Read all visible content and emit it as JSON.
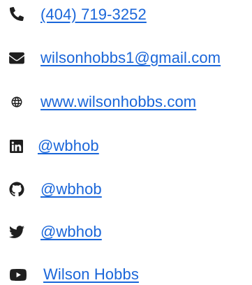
{
  "contacts": [
    {
      "icon": "phone-icon",
      "text": "(404) 719-3252"
    },
    {
      "icon": "envelope-icon",
      "text": "wilsonhobbs1@gmail.com"
    },
    {
      "icon": "globe-icon",
      "text": "www.wilsonhobbs.com"
    },
    {
      "icon": "linkedin-icon",
      "text": "@wbhob"
    },
    {
      "icon": "github-icon",
      "text": "@wbhob"
    },
    {
      "icon": "twitter-icon",
      "text": "@wbhob"
    },
    {
      "icon": "youtube-icon",
      "text": "Wilson Hobbs"
    }
  ],
  "colors": {
    "link": "#1a66d9",
    "icon": "#1f1f1f",
    "background": "#ffffff"
  }
}
